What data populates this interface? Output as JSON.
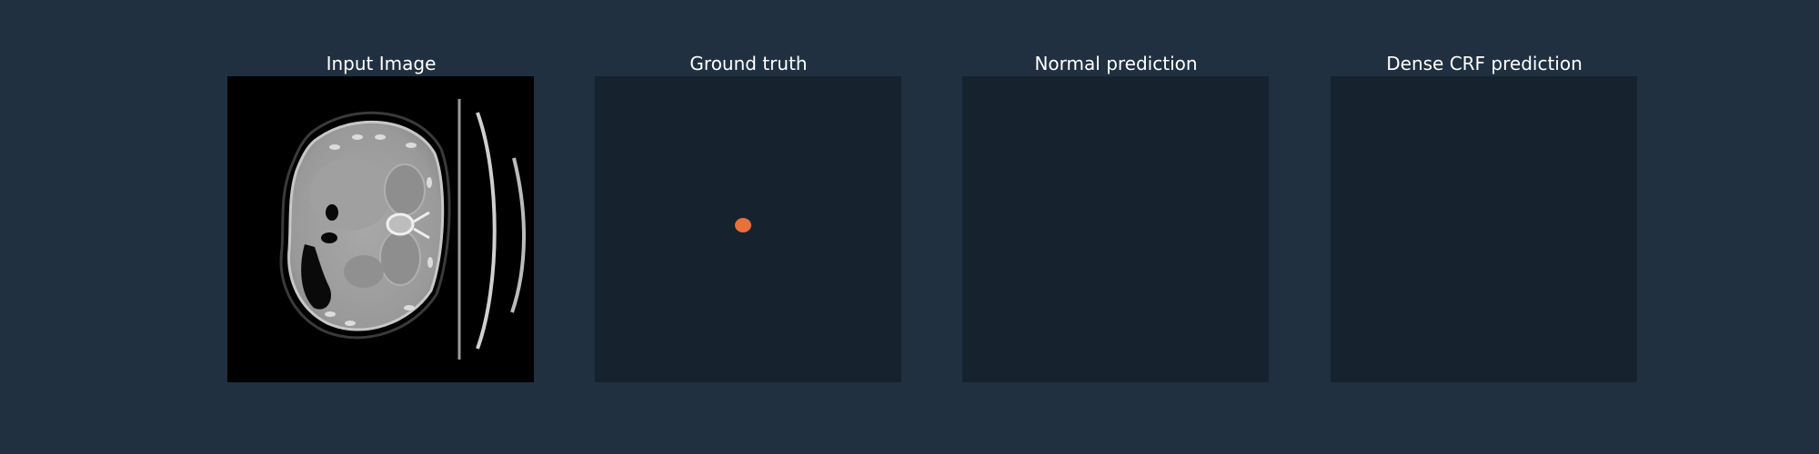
{
  "panels": [
    {
      "title": "Input Image"
    },
    {
      "title": "Ground truth"
    },
    {
      "title": "Normal prediction"
    },
    {
      "title": "Dense CRF prediction"
    }
  ],
  "colors": {
    "figure_background": "#203040",
    "mask_background": "#16222e",
    "ground_truth_lesion": "#e8703a"
  }
}
